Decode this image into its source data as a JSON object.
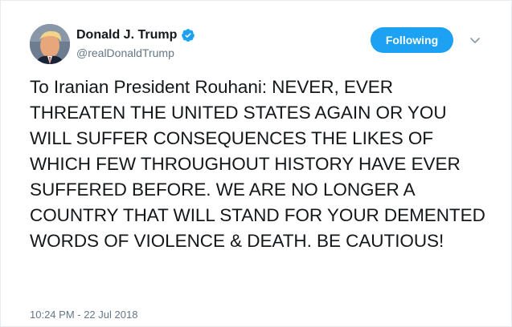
{
  "tweet": {
    "author": {
      "display_name": "Donald J. Trump",
      "handle": "@realDonaldTrump",
      "verified": true,
      "verified_icon": "verified-badge-icon"
    },
    "follow_button_label": "Following",
    "text": "To Iranian President Rouhani: NEVER, EVER THREATEN THE UNITED STATES AGAIN OR YOU WILL SUFFER CONSEQUENCES THE LIKES OF WHICH FEW THROUGHOUT HISTORY HAVE EVER SUFFERED BEFORE. WE ARE NO LONGER A COUNTRY THAT WILL STAND FOR YOUR DEMENTED WORDS OF VIOLENCE & DEATH. BE CAUTIOUS!",
    "timestamp": "10:24 PM - 22 Jul 2018",
    "more_menu_icon": "chevron-down-icon"
  },
  "colors": {
    "accent": "#1da1f2",
    "text_primary": "#14171a",
    "text_secondary": "#657786",
    "border": "#e6ecf0"
  }
}
